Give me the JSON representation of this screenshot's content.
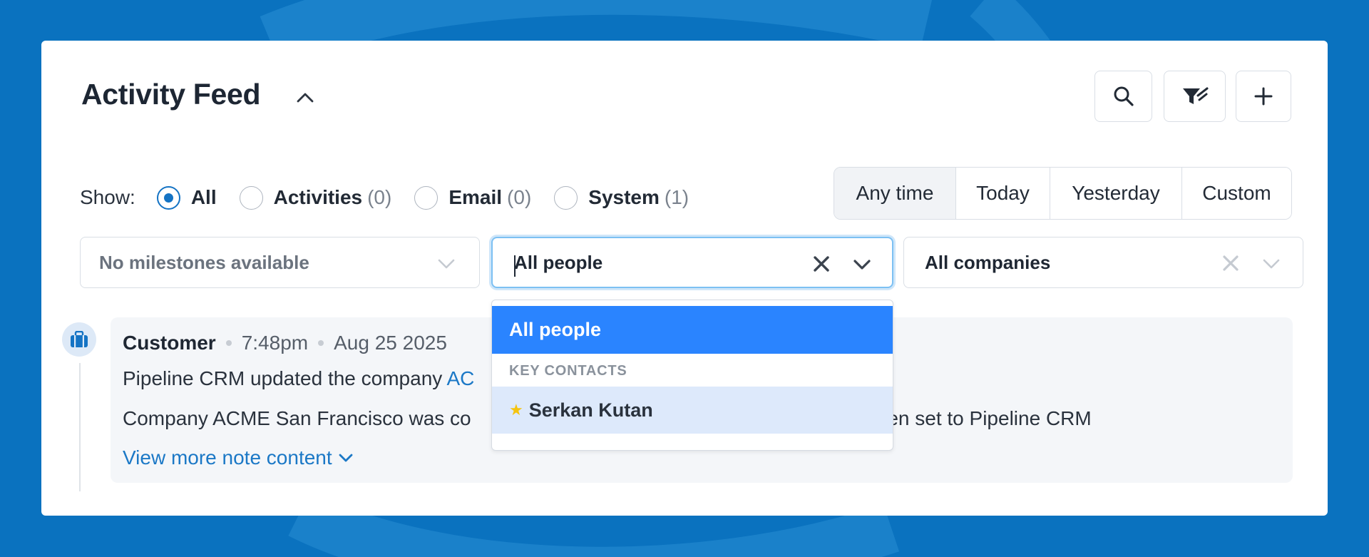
{
  "header": {
    "title": "Activity Feed"
  },
  "toolbar": {
    "search_icon": "search-icon",
    "filter_icon": "filter-icon",
    "add_icon": "plus-icon"
  },
  "show_filter": {
    "label": "Show:",
    "options": [
      {
        "label": "All",
        "count": "",
        "checked": true
      },
      {
        "label": "Activities",
        "count": "(0)",
        "checked": false
      },
      {
        "label": "Email",
        "count": "(0)",
        "checked": false
      },
      {
        "label": "System",
        "count": "(1)",
        "checked": false
      }
    ]
  },
  "time_filter": {
    "options": [
      "Any time",
      "Today",
      "Yesterday",
      "Custom"
    ],
    "selected": "Any time"
  },
  "selects": {
    "milestones": {
      "value": "No milestones available"
    },
    "people": {
      "value": "All people"
    },
    "companies": {
      "value": "All companies"
    }
  },
  "people_dropdown": {
    "active_item": "All people",
    "group_label": "KEY CONTACTS",
    "items": [
      {
        "label": "Serkan Kutan",
        "starred": true
      }
    ]
  },
  "activity": {
    "type": "Customer",
    "time": "7:48pm",
    "date": "Aug 25 2025",
    "line1_prefix": "Pipeline CRM updated the company ",
    "line1_link": "AC",
    "line2_start": "Company ACME San Francisco was co",
    "line2_end": "been set to Pipeline CRM",
    "more_link": "View more note content"
  },
  "colors": {
    "background": "#0a72bf",
    "accent": "#1473c4",
    "dropdown_active": "#2a84ff",
    "dropdown_hover": "#dde9fb",
    "star": "#f5c40f"
  }
}
